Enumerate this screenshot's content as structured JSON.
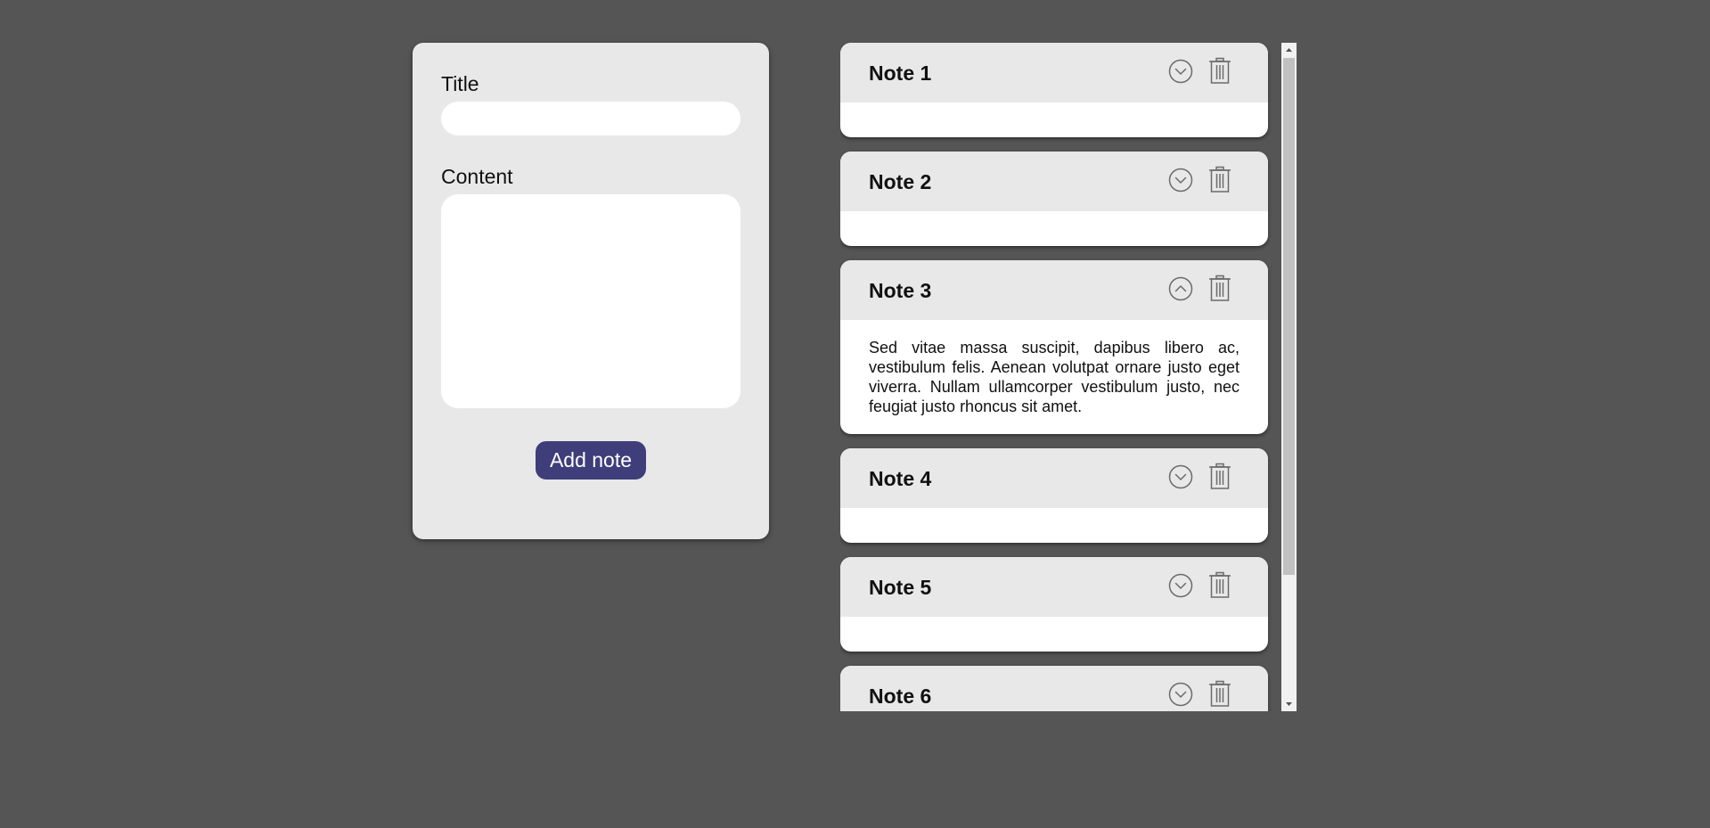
{
  "form": {
    "title_label": "Title",
    "title_value": "",
    "title_placeholder": "",
    "content_label": "Content",
    "content_value": "",
    "content_placeholder": "",
    "add_button_label": "Add note"
  },
  "notes": [
    {
      "title": "Note 1",
      "expanded": false,
      "content": ""
    },
    {
      "title": "Note 2",
      "expanded": false,
      "content": ""
    },
    {
      "title": "Note 3",
      "expanded": true,
      "content": "Sed vitae massa suscipit, dapibus libero ac, vestibulum felis. Aenean volutpat ornare justo eget viverra. Nullam ullamcorper vestibulum justo, nec feugiat justo rhoncus sit amet."
    },
    {
      "title": "Note 4",
      "expanded": false,
      "content": ""
    },
    {
      "title": "Note 5",
      "expanded": false,
      "content": ""
    },
    {
      "title": "Note 6",
      "expanded": false,
      "content": ""
    }
  ],
  "icons": {
    "expand": "chevron-down-circle-icon",
    "collapse": "chevron-up-circle-icon",
    "delete": "trash-icon"
  },
  "colors": {
    "background": "#555555",
    "panel": "#e8e8e8",
    "accent": "#3f3d7a",
    "icon": "#6b6b6b"
  }
}
